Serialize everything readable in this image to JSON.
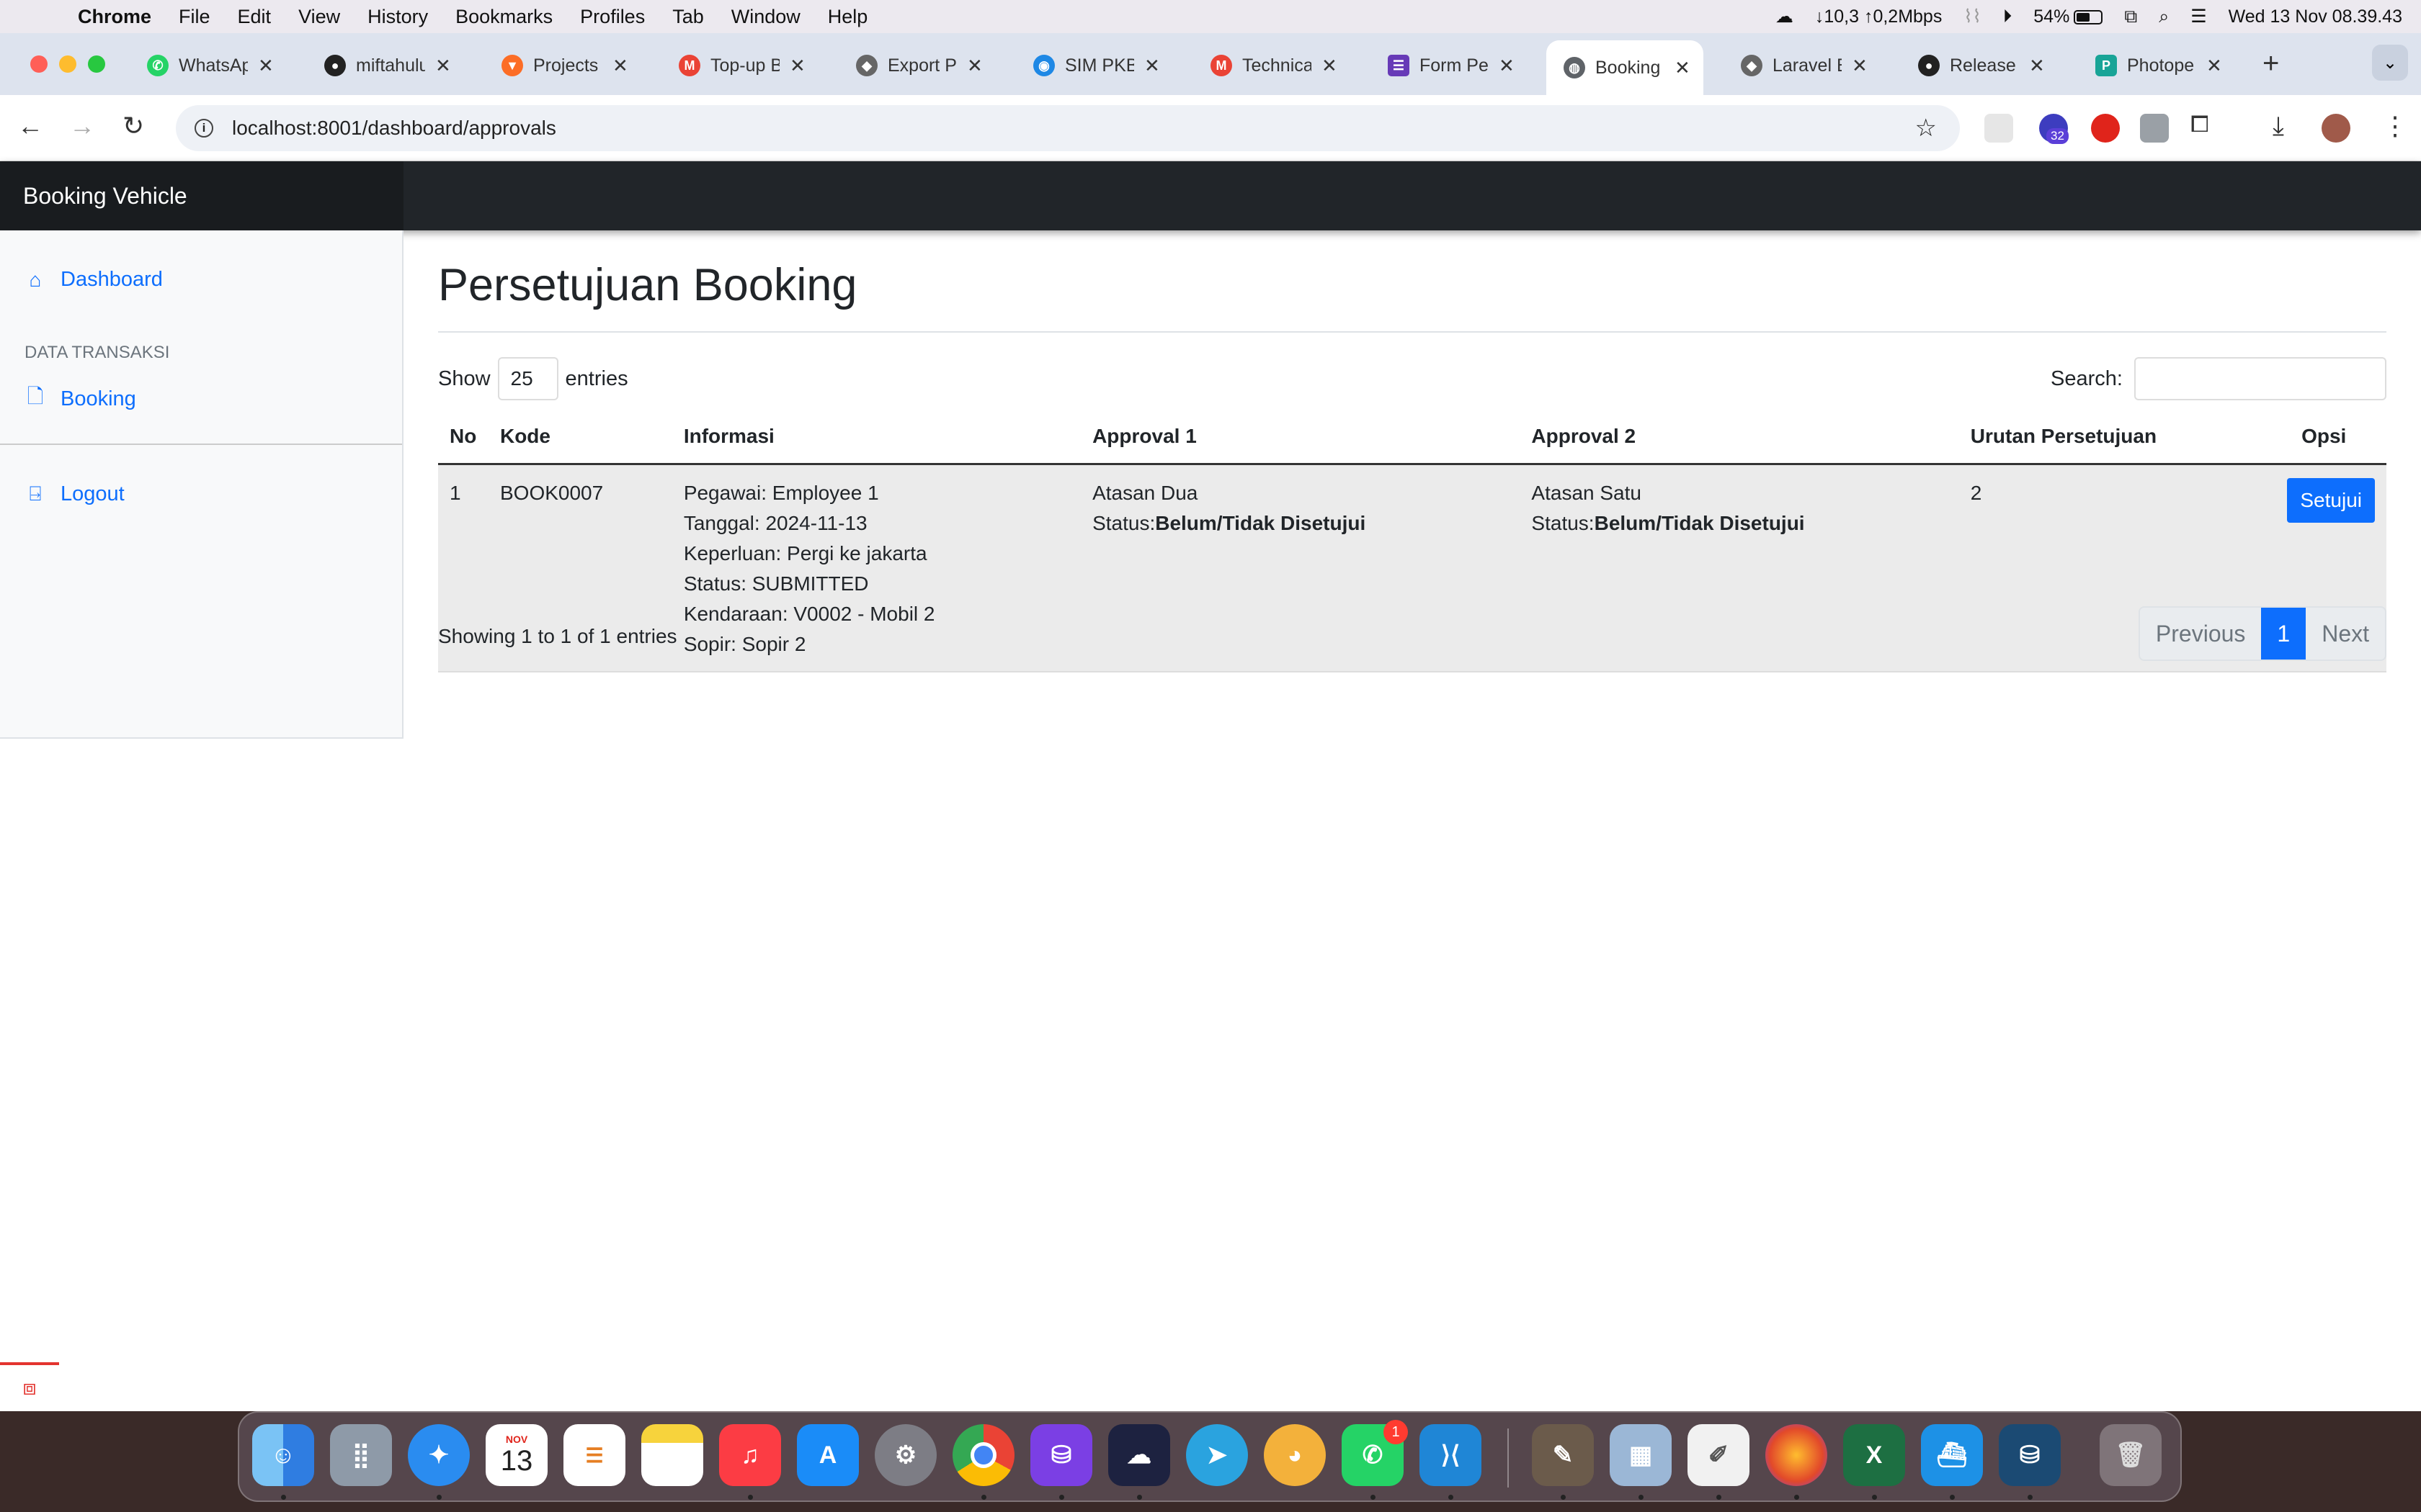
{
  "menubar": {
    "app_name": "Chrome",
    "items": [
      "File",
      "Edit",
      "View",
      "History",
      "Bookmarks",
      "Profiles",
      "Tab",
      "Window",
      "Help"
    ],
    "network": "↓10,3 ↑0,2Mbps",
    "battery": "54%",
    "datetime": "Wed 13 Nov  08.39.43"
  },
  "tabs": [
    {
      "title": "WhatsAp",
      "icon": "whatsapp-icon",
      "color": "#25d366"
    },
    {
      "title": "miftahulu",
      "icon": "github-icon",
      "color": "#222222"
    },
    {
      "title": "Projects",
      "icon": "gitlab-icon",
      "color": "#fc6d26"
    },
    {
      "title": "Top-up B",
      "icon": "gmail-icon",
      "color": "#ea4335"
    },
    {
      "title": "Export Pl",
      "icon": "cube-icon",
      "color": "#666666"
    },
    {
      "title": "SIM PKB",
      "icon": "sim-pkb-icon",
      "color": "#1e88e5"
    },
    {
      "title": "Technica",
      "icon": "gmail-icon",
      "color": "#ea4335"
    },
    {
      "title": "Form Per",
      "icon": "forms-icon",
      "color": "#673ab7"
    },
    {
      "title": "Booking",
      "icon": "globe-icon",
      "color": "#5f6368",
      "active": true
    },
    {
      "title": "Laravel E",
      "icon": "cube-icon",
      "color": "#666666"
    },
    {
      "title": "Release",
      "icon": "github-icon",
      "color": "#222222"
    },
    {
      "title": "Photope",
      "icon": "photopea-icon",
      "color": "#18a497"
    }
  ],
  "toolbar": {
    "url": "localhost:8001/dashboard/approvals",
    "extension_badge": "32"
  },
  "app": {
    "brand": "Booking Vehicle",
    "sidebar": {
      "dashboard": "Dashboard",
      "section_heading": "DATA TRANSAKSI",
      "booking": "Booking",
      "logout": "Logout"
    },
    "page_title": "Persetujuan Booking",
    "length": {
      "show": "Show",
      "value": "25",
      "entries": "entries"
    },
    "search_label": "Search:",
    "table": {
      "columns": [
        "No",
        "Kode",
        "Informasi",
        "Approval 1",
        "Approval 2",
        "Urutan Persetujuan",
        "Opsi"
      ],
      "rows": [
        {
          "no": "1",
          "kode": "BOOK0007",
          "info": [
            "Pegawai: Employee 1",
            "Tanggal: 2024-11-13",
            "Keperluan: Pergi ke jakarta",
            "Status: SUBMITTED",
            "Kendaraan: V0002 - Mobil 2",
            "Sopir: Sopir 2"
          ],
          "approval1": {
            "name": "Atasan Dua",
            "status_label": "Status:",
            "status": "Belum/Tidak Disetujui"
          },
          "approval2": {
            "name": "Atasan Satu",
            "status_label": "Status:",
            "status": "Belum/Tidak Disetujui"
          },
          "urutan": "2",
          "action": "Setujui"
        }
      ]
    },
    "info_text": "Showing 1 to 1 of 1 entries",
    "pagination": {
      "previous": "Previous",
      "current": "1",
      "next": "Next"
    }
  },
  "dock": {
    "calendar_month": "NOV",
    "calendar_day": "13",
    "whatsapp_badge": "1"
  },
  "colors": {
    "primary": "#0d6efd",
    "navbar": "#212529",
    "sidebar": "#f8f9fa"
  }
}
